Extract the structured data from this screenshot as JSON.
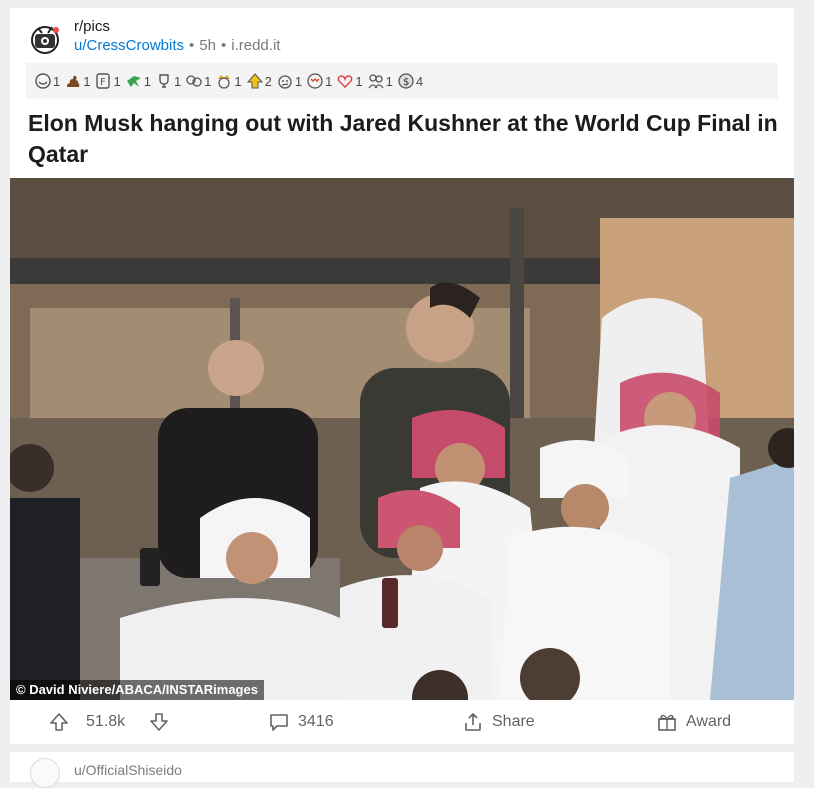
{
  "post": {
    "subreddit": "r/pics",
    "username": "u/CressCrowbits",
    "age": "5h",
    "domain": "i.redd.it",
    "title": "Elon Musk hanging out with Jared Kushner at the World Cup Final in Qatar",
    "image_credit": "© David Niviere/ABACA/INSTARimages"
  },
  "awards": [
    {
      "icon": "laughing-face-icon",
      "count": "1"
    },
    {
      "icon": "poop-icon",
      "count": "1"
    },
    {
      "icon": "f-respects-icon",
      "count": "1"
    },
    {
      "icon": "bird-icon",
      "count": "1"
    },
    {
      "icon": "trophy-icon",
      "count": "1"
    },
    {
      "icon": "two-faces-icon",
      "count": "1"
    },
    {
      "icon": "crown-face-icon",
      "count": "1"
    },
    {
      "icon": "upvote-star-icon",
      "count": "2"
    },
    {
      "icon": "confused-face-icon",
      "count": "1"
    },
    {
      "icon": "heart-eyes-icon",
      "count": "1"
    },
    {
      "icon": "love-face-icon",
      "count": "1"
    },
    {
      "icon": "people-icon",
      "count": "1"
    },
    {
      "icon": "dollar-coin-icon",
      "count": "4"
    }
  ],
  "actions": {
    "score": "51.8k",
    "comments": "3416",
    "share_label": "Share",
    "award_label": "Award"
  },
  "next_post": {
    "username": "u/OfficialShiseido"
  },
  "colors": {
    "username_blue": "#0079d3",
    "meta_gray": "#787c7e",
    "background": "#eeeff1"
  }
}
